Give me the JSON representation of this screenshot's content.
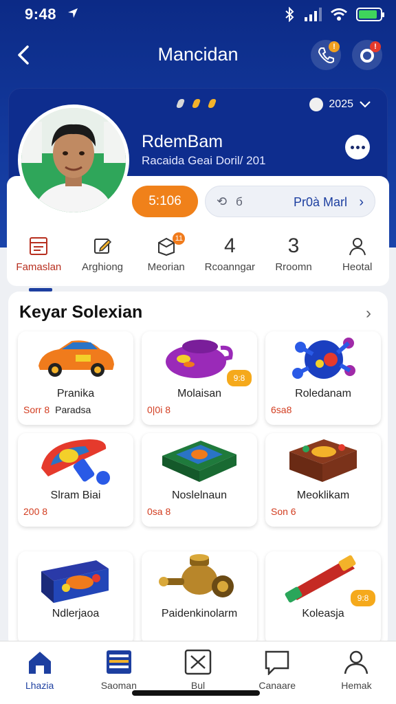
{
  "status_bar": {
    "time": "9:48"
  },
  "header": {
    "title": "Mancidan",
    "badge_call": "!",
    "badge_notify": "!"
  },
  "profile": {
    "year": "2025",
    "name": "RdemBam",
    "subtitle": "Racaida Geai Doril/ 201",
    "points": "5:106",
    "promo_code": "б",
    "promo_label": "Pr0à Marl"
  },
  "tabs": [
    {
      "label": "Famaslan",
      "icon": "document-icon"
    },
    {
      "label": "Arghiong",
      "icon": "edit-icon"
    },
    {
      "label": "Meorian",
      "icon": "box-icon",
      "badge": "11"
    },
    {
      "label": "Rcoanngar",
      "icon": "4"
    },
    {
      "label": "Rroomn",
      "icon": "3"
    },
    {
      "label": "Heotal",
      "icon": "person-icon"
    }
  ],
  "section": {
    "title": "Keyar Solexian",
    "items": [
      {
        "name": "Pranika",
        "price": "Sorr 8",
        "sub": "Paradsa",
        "icon": "race-car-icon"
      },
      {
        "name": "Molaisan",
        "price": "0|0i 8",
        "badge": "9:8",
        "icon": "purple-pot-icon"
      },
      {
        "name": "Roledanam",
        "price": "6sa8",
        "icon": "blue-ball-icon"
      },
      {
        "name": "Slram Biai",
        "price": "200 8",
        "icon": "toy-gun-icon"
      },
      {
        "name": "Noslelnaun",
        "price": "0sa 8",
        "icon": "green-board-icon"
      },
      {
        "name": "Meoklikam",
        "price": "Son 6",
        "icon": "brown-box-icon"
      },
      {
        "name": "Ndlerjaoa",
        "price": "",
        "icon": "game-box-icon"
      },
      {
        "name": "Paidenkinolarm",
        "price": "",
        "icon": "brass-engine-icon"
      },
      {
        "name": "Koleasja",
        "price": "",
        "badge": "9:8",
        "icon": "red-tube-icon"
      }
    ]
  },
  "bottom_nav": [
    {
      "label": "Lhazia",
      "icon": "home-icon"
    },
    {
      "label": "Saoman",
      "icon": "list-icon"
    },
    {
      "label": "Bul",
      "icon": "x-box-icon"
    },
    {
      "label": "Canaare",
      "icon": "chat-icon"
    },
    {
      "label": "Hemak",
      "icon": "person-icon"
    }
  ],
  "colors": {
    "brand": "#0c2a86",
    "accent": "#f0811a",
    "link": "#1d3fa0"
  }
}
